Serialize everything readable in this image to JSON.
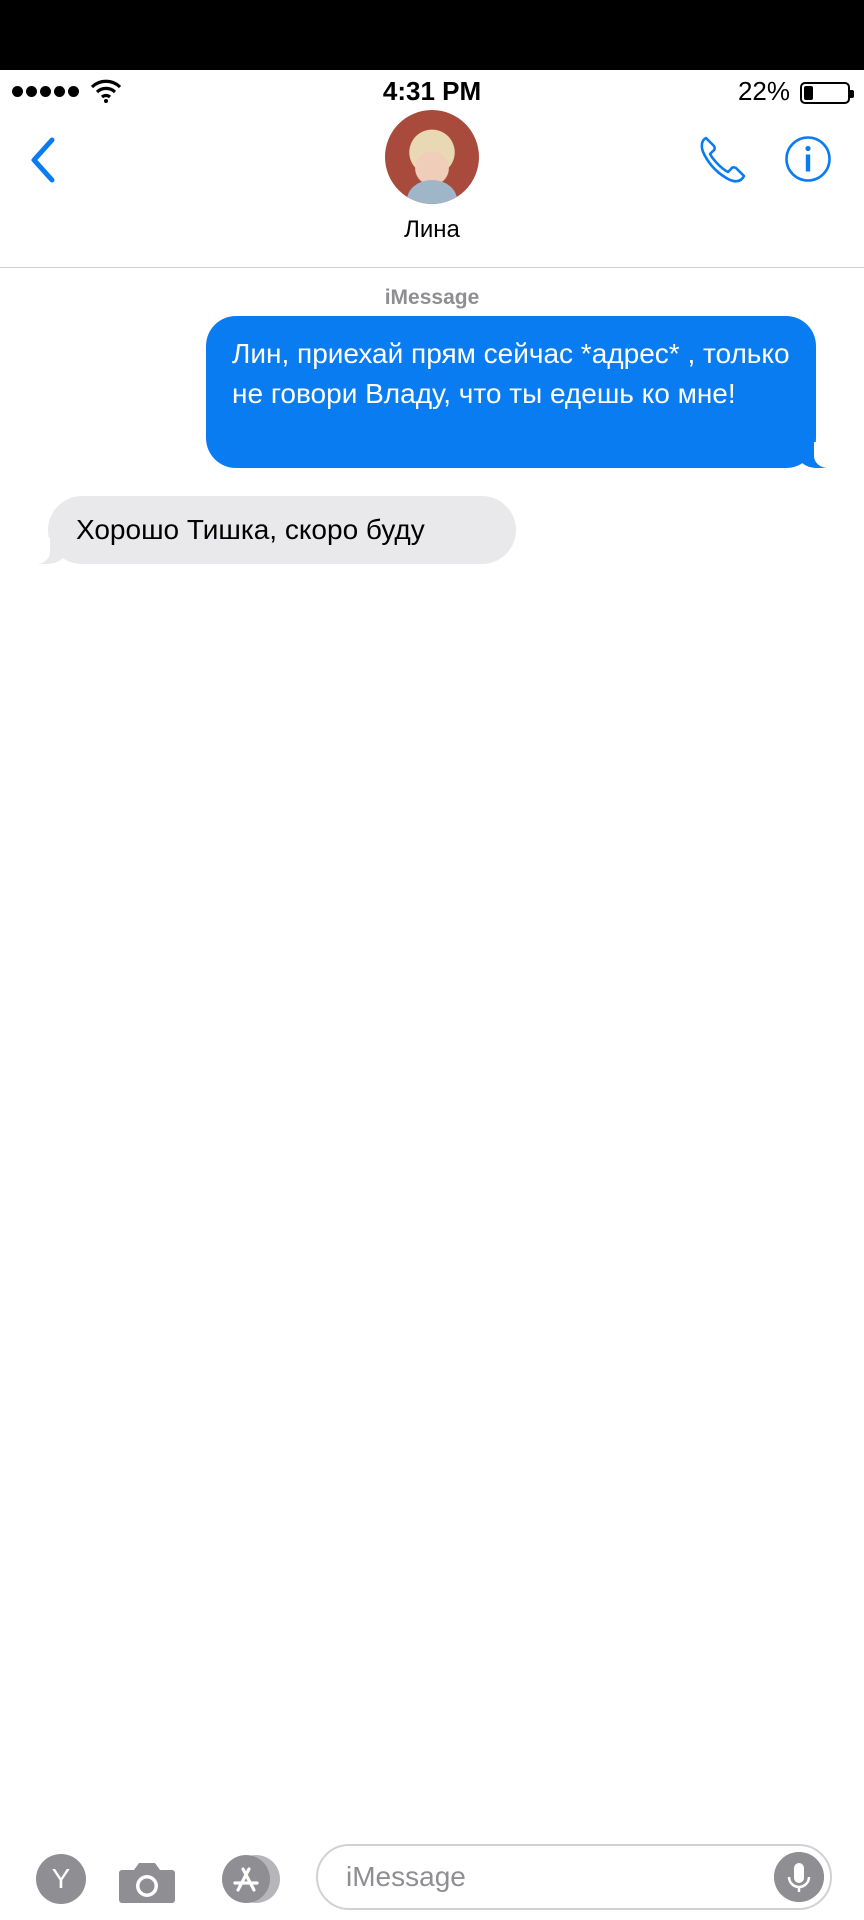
{
  "status_bar": {
    "time": "4:31 PM",
    "battery_percent": "22%",
    "battery_level": 0.22,
    "signal_bars": 5
  },
  "navbar": {
    "contact_name": "Лина",
    "back_icon": "chevron-left-icon",
    "call_icon": "phone-icon",
    "info_icon": "info-icon"
  },
  "conversation": {
    "service_label": "iMessage",
    "messages": [
      {
        "direction": "sent",
        "text": "Лин, приехай прям сейчас *адрес* , только не говори Владу, что ты едешь ко мне!"
      },
      {
        "direction": "received",
        "text": "Хорошо Тишка, скоро буду"
      }
    ]
  },
  "input_bar": {
    "y_button_label": "Y",
    "placeholder": "iMessage",
    "camera_icon": "camera-icon",
    "appstore_icon": "appstore-icon",
    "mic_icon": "microphone-icon"
  },
  "colors": {
    "accent": "#0a7cf2",
    "sent_bubble": "#0a7cf2",
    "received_bubble": "#e9e9eb",
    "secondary_text": "#8e8e93"
  }
}
